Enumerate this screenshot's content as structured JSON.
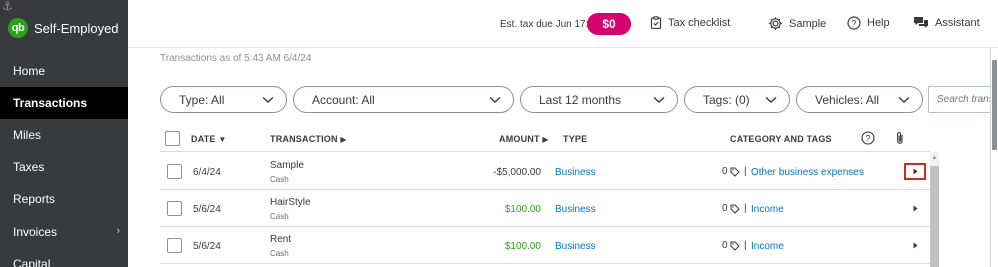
{
  "sidebar": {
    "brand": "Self-Employed",
    "logo_text": "qb",
    "items": [
      {
        "label": "Home"
      },
      {
        "label": "Transactions"
      },
      {
        "label": "Miles"
      },
      {
        "label": "Taxes"
      },
      {
        "label": "Reports"
      },
      {
        "label": "Invoices"
      },
      {
        "label": "Capital"
      }
    ]
  },
  "topbar": {
    "est_tax_label": "Est. tax due Jun 17:",
    "est_tax_value": "$0",
    "tax_checklist": "Tax checklist",
    "sample": "Sample",
    "help": "Help",
    "assistant": "Assistant"
  },
  "content": {
    "as_of": "Transactions as of 5:43 AM 6/4/24",
    "filters": {
      "type": "Type: All",
      "account": "Account: All",
      "period": "Last 12 months",
      "tags": "Tags: (0)",
      "vehicles": "Vehicles: All"
    },
    "search_placeholder": "Search transactions",
    "headers": {
      "date": "DATE",
      "transaction": "TRANSACTION",
      "amount": "AMOUNT",
      "type": "TYPE",
      "category": "CATEGORY AND TAGS"
    },
    "rows": [
      {
        "date": "6/4/24",
        "name": "Sample",
        "account": "Cash",
        "amount": "-$5,000.00",
        "type": "Business",
        "tags": "0",
        "category": "Other business expenses"
      },
      {
        "date": "5/6/24",
        "name": "HairStyle",
        "account": "Cash",
        "amount": "$100.00",
        "type": "Business",
        "tags": "0",
        "category": "Income"
      },
      {
        "date": "5/6/24",
        "name": "Rent",
        "account": "Cash",
        "amount": "$100.00",
        "type": "Business",
        "tags": "0",
        "category": "Income"
      }
    ]
  },
  "colors": {
    "sidebar_bg": "#393a3d",
    "active_nav": "#000000",
    "tax_pill": "#d6006e",
    "brand_green": "#2ca01c",
    "link_blue": "#0077c5",
    "highlight_red": "#d52b1e"
  }
}
